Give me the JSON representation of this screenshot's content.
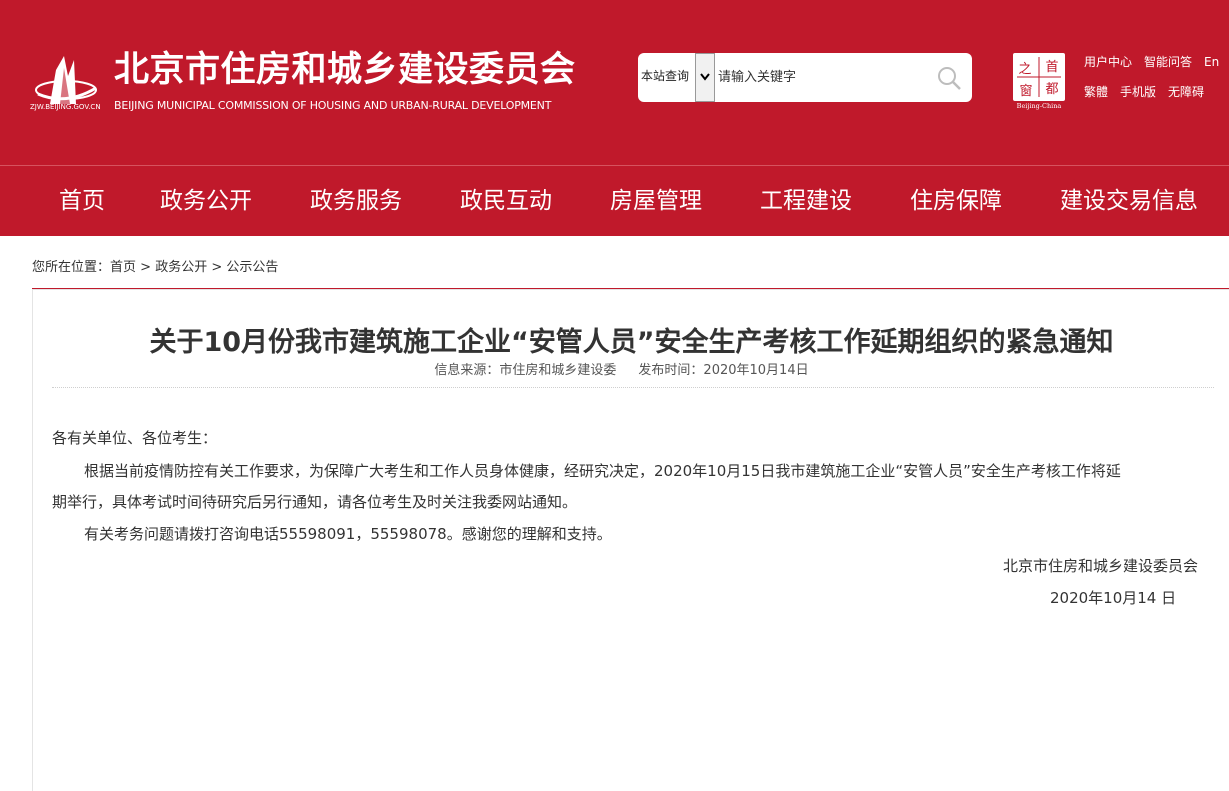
{
  "header": {
    "logo_small_text": "ZJW.BEIJING.GOV.CN",
    "site_title": "北京市住房和城乡建设委员会",
    "site_subtitle": "BEIJING MUNICIPAL COMMISSION OF HOUSING AND URBAN-RURAL DEVELOPMENT",
    "search": {
      "scope": "本站查询",
      "placeholder": "请输入关键字"
    },
    "capital_logo": {
      "chars": [
        "之",
        "首",
        "窗",
        "都"
      ],
      "caption": "Beijing-China"
    },
    "links_row1": [
      "用户中心",
      "智能问答",
      "En"
    ],
    "links_row2": [
      "繁體",
      "手机版",
      "无障碍"
    ],
    "accent_color": "#c0192b"
  },
  "nav": {
    "items": [
      "首页",
      "政务公开",
      "政务服务",
      "政民互动",
      "房屋管理",
      "工程建设",
      "住房保障",
      "建设交易信息"
    ]
  },
  "breadcrumb": {
    "prefix": "您所在位置：",
    "items": [
      "首页",
      "政务公开",
      "公示公告"
    ],
    "separator": " > "
  },
  "article": {
    "title": "关于10月份我市建筑施工企业“安管人员”安全生产考核工作延期组织的紧急通知",
    "source_label": "信息来源：市住房和城乡建设委",
    "date_label": "发布时间：2020年10月14日",
    "greeting": "各有关单位、各位考生：",
    "para1_line1": "根据当前疫情防控有关工作要求，为保障广大考生和工作人员身体健康，经研究决定，2020年10月15日我市建筑施工企业“安管人员”安全生产考核工作将延",
    "para1_line2": "期举行，具体考试时间待研究后另行通知，请各位考生及时关注我委网站通知。",
    "para2": "有关考务问题请拨打咨询电话55598091，55598078。感谢您的理解和支持。",
    "signature": "北京市住房和城乡建设委员会",
    "sign_date": "2020年10月14 日"
  }
}
